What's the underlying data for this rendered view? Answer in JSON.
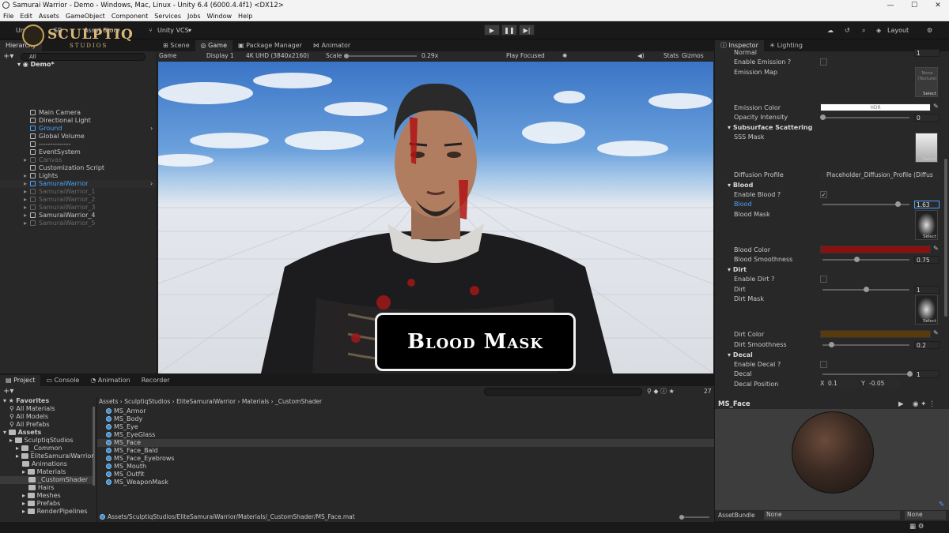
{
  "window": {
    "title": "Samurai Warrior - Demo - Windows, Mac, Linux - Unity 6.4 (6000.4.4f1) <DX12>",
    "min": "—",
    "max": "☐",
    "close": "✕"
  },
  "menu": [
    "File",
    "Edit",
    "Assets",
    "GameObject",
    "Component",
    "Services",
    "Jobs",
    "Window",
    "Help"
  ],
  "toolbar": {
    "account": "Unity",
    "sr": "SR",
    "asset_store": "Asset Store",
    "vcs": "Unity VCS",
    "layout": "Layout",
    "logo": "SCULPTIQ",
    "logo_sub": "STUDIOS"
  },
  "scene_tabs": [
    "Scene",
    "Game",
    "Package Manager",
    "Animator"
  ],
  "game_bar": {
    "mode": "Game",
    "display": "Display 1",
    "resolution": "4K UHD (3840x2160)",
    "scale_label": "Scale",
    "scale_value": "0.29x",
    "play_focused": "Play Focused",
    "stats": "Stats",
    "gizmos": "Gizmos"
  },
  "hierarchy": {
    "tab": "Hierarchy",
    "search": "All",
    "scene": "Demo*",
    "items": [
      "Main Camera",
      "Directional Light",
      "Ground",
      "Global Volume",
      "--------------",
      "EventSystem",
      "Canvas",
      "Customization Script",
      "Lights",
      "SamuraiWarrior",
      "SamuraiWarrior_1",
      "SamuraiWarrior_2",
      "SamuraiWarrior_3",
      "SamuraiWarrior_4",
      "SamuraiWarrior_5"
    ]
  },
  "inspector": {
    "tabs": [
      "Inspector",
      "Lighting"
    ],
    "rows": {
      "normal": "Normal",
      "normal_val": "1",
      "enable_emission": "Enable Emission ?",
      "emission_map": "Emission Map",
      "none_texture": "None (Texture)",
      "select": "Select",
      "emission_color": "Emission Color",
      "hdr": "HDR",
      "opacity": "Opacity Intensity",
      "opacity_val": "0",
      "sss_head": "Subsurface Scattering",
      "sss_mask": "SSS Mask",
      "diffusion": "Diffusion Profile",
      "diffusion_val": "Placeholder_Diffusion_Profile (Diffus",
      "blood_head": "Blood",
      "enable_blood": "Enable Blood ?",
      "blood": "Blood",
      "blood_val": "1.63",
      "blood_mask": "Blood Mask",
      "blood_color": "Blood Color",
      "blood_smooth": "Blood Smoothness",
      "blood_smooth_val": "0.75",
      "dirt_head": "Dirt",
      "enable_dirt": "Enable Dirt ?",
      "dirt": "Dirt",
      "dirt_val": "1",
      "dirt_mask": "Dirt Mask",
      "dirt_color": "Dirt Color",
      "dirt_smooth": "Dirt Smoothness",
      "dirt_smooth_val": "0.2",
      "decal_head": "Decal",
      "enable_decal": "Enable Decal ?",
      "decal": "Decal",
      "decal_val": "1",
      "decal_pos": "Decal Position",
      "x": "X",
      "x_val": "0.1",
      "y": "Y",
      "y_val": "-0.05"
    },
    "levels": {
      "blood": 0.5,
      "blood_smooth": 0.3,
      "dirt": 0.4,
      "dirt_smooth": 0.1,
      "decal": 0.8
    },
    "colors": {
      "blood": "#8b1111",
      "dirt": "#5a3a0a",
      "emission": "#ffffff"
    }
  },
  "preview": {
    "name": "MS_Face"
  },
  "asset_bundle": {
    "label": "AssetBundle",
    "value": "None",
    "variant": "None"
  },
  "project": {
    "tabs": [
      "Project",
      "Console",
      "Animation",
      "Recorder"
    ],
    "count": "27",
    "tree": [
      [
        "Favorites",
        0,
        true
      ],
      [
        "All Materials",
        1,
        false
      ],
      [
        "All Models",
        1,
        false
      ],
      [
        "All Prefabs",
        1,
        false
      ],
      [
        "Assets",
        0,
        true
      ],
      [
        "SculptiqStudios",
        1,
        true
      ],
      [
        "_Common",
        2,
        true
      ],
      [
        "EliteSamuraiWarrior",
        2,
        true
      ],
      [
        "Animations",
        3,
        true
      ],
      [
        "Materials",
        3,
        true
      ],
      [
        "_CustomShader",
        4,
        true
      ],
      [
        "Hairs",
        4,
        true
      ],
      [
        "Meshes",
        3,
        true
      ],
      [
        "Prefabs",
        3,
        true
      ],
      [
        "RenderPipelines",
        3,
        true
      ]
    ],
    "breadcrumb": [
      "Assets",
      "SculptiqStudios",
      "EliteSamuraiWarrior",
      "Materials",
      "_CustomShader"
    ],
    "files": [
      "MS_Armor",
      "MS_Body",
      "MS_Eye",
      "MS_EyeGlass",
      "MS_Face",
      "MS_Face_Bald",
      "MS_Face_Eyebrows",
      "MS_Mouth",
      "MS_Outfit",
      "MS_WeaponMask"
    ],
    "path": "Assets/SculptiqStudios/EliteSamuraiWarrior/Materials/_CustomShader/MS_Face.mat"
  },
  "overlay": {
    "caption": "Blood Mask"
  }
}
